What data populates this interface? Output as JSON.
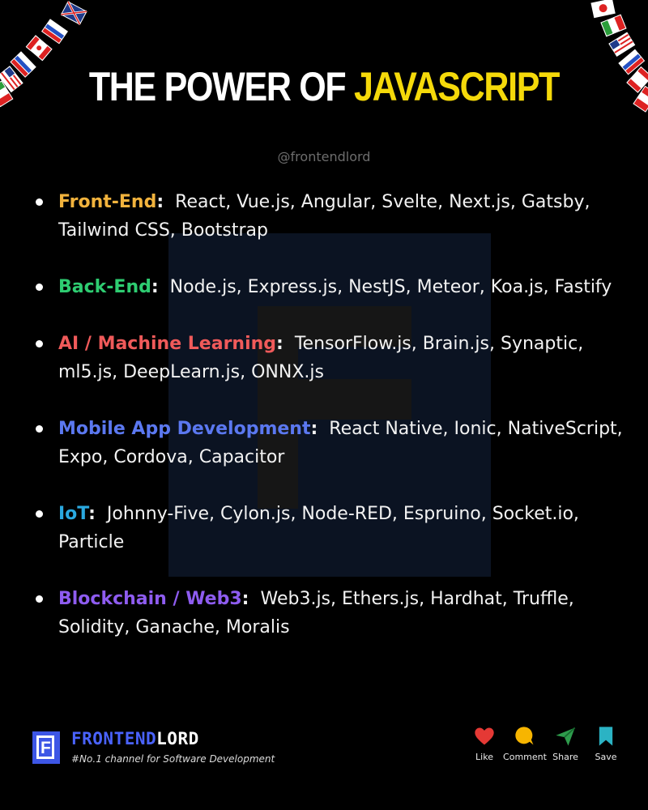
{
  "header": {
    "title_white": "THE POWER OF",
    "title_yellow": "JAVASCRIPT",
    "handle": "@frontendlord"
  },
  "items": [
    {
      "category": "Front-End",
      "color": "#f2b33d",
      "text": "React, Vue.js, Angular, Svelte, Next.js, Gatsby, Tailwind CSS, Bootstrap"
    },
    {
      "category": "Back-End",
      "color": "#2ecc71",
      "text": "Node.js, Express.js, NestJS, Meteor, Koa.js, Fastify"
    },
    {
      "category": "AI / Machine Learning",
      "color": "#f05a5a",
      "text": "TensorFlow.js, Brain.js, Synaptic, ml5.js, DeepLearn.js, ONNX.js"
    },
    {
      "category": "Mobile App Development",
      "color": "#5b78f0",
      "text": "React Native, Ionic, NativeScript, Expo, Cordova, Capacitor"
    },
    {
      "category": "IoT",
      "color": "#2aa9e0",
      "text": "Johnny-Five, Cylon.js, Node-RED, Espruino, Socket.io, Particle"
    },
    {
      "category": "Blockchain / Web3",
      "color": "#8e5cf0",
      "text": "Web3.js, Ethers.js, Hardhat, Truffle, Solidity, Ganache, Moralis"
    }
  ],
  "footer": {
    "logo_letter": "F",
    "brand_part1": "FRONTEND",
    "brand_part2": "LORD",
    "tagline": "#No.1 channel for Software Development",
    "actions": [
      {
        "label": "Like",
        "icon": "heart-icon"
      },
      {
        "label": "Comment",
        "icon": "comment-icon"
      },
      {
        "label": "Share",
        "icon": "share-icon"
      },
      {
        "label": "Save",
        "icon": "bookmark-icon"
      }
    ]
  }
}
